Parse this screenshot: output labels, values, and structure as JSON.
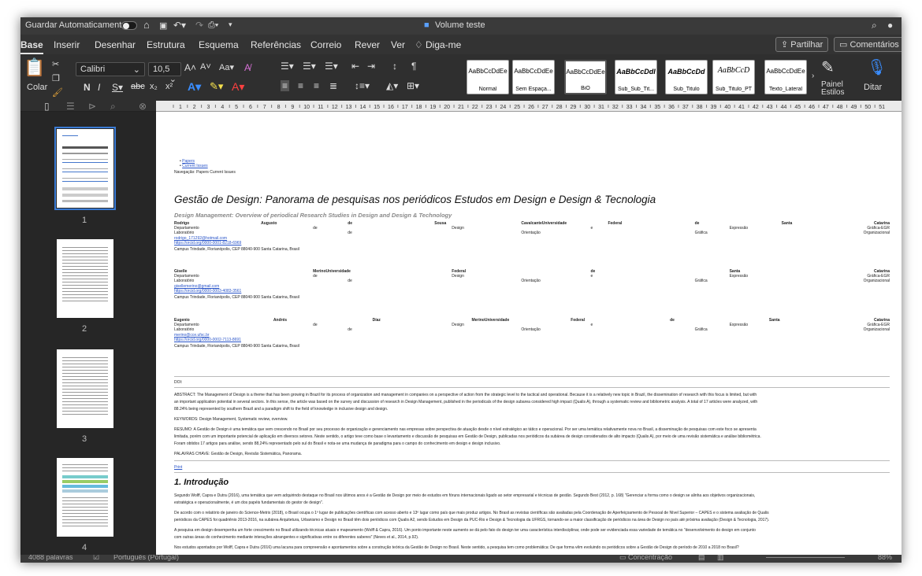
{
  "titlebar": {
    "autosave": "Guardar Automaticamente",
    "doc_title": "Volume teste"
  },
  "menu": {
    "tabs": [
      "Base",
      "Inserir",
      "Desenhar",
      "Estrutura",
      "Esquema",
      "Referências",
      "Correio",
      "Rever",
      "Ver"
    ],
    "tell_me": "Diga-me",
    "share": "Partilhar",
    "comments": "Comentários"
  },
  "ribbon": {
    "paste": "Colar",
    "font": "Calibri",
    "size": "10,5",
    "styles_pane": "Painel Estilos",
    "dictate": "Ditar",
    "styles": [
      {
        "preview": "AaBbCcDdEe",
        "name": "Normal"
      },
      {
        "preview": "AaBbCcDdEe",
        "name": "Sem Espaça..."
      },
      {
        "preview": "AaBbCcDdEe",
        "name": "BiO"
      },
      {
        "preview": "AaBbCcDdI",
        "name": "Sub_Sub_Tit..."
      },
      {
        "preview": "AaBbCcDd",
        "name": "Sub_Titulo"
      },
      {
        "preview": "AaBbCcD",
        "name": "Sub_Titulo_PT"
      },
      {
        "preview": "AaBbCcDdEe",
        "name": "Texto_Lateral"
      }
    ]
  },
  "nav": {
    "pages": [
      "1",
      "2",
      "3",
      "4"
    ]
  },
  "ruler": [
    "1",
    "2",
    "3",
    "4",
    "5",
    "6",
    "7",
    "8",
    "9",
    "10",
    "11",
    "12",
    "13",
    "14",
    "15",
    "16",
    "17",
    "18",
    "19",
    "20",
    "21",
    "22",
    "23",
    "24",
    "25",
    "26",
    "27",
    "28",
    "29",
    "30",
    "31",
    "32",
    "33",
    "34",
    "35",
    "36",
    "37",
    "38",
    "39",
    "40",
    "41",
    "42",
    "43",
    "44",
    "45",
    "46",
    "47",
    "48",
    "49",
    "50",
    "51"
  ],
  "doc": {
    "links": [
      "Papers",
      "Current Issues"
    ],
    "breadcrumb": "Navegação: Papers Current Issues",
    "title": "Gestão de Design: Panorama de pesquisas nos periódicos Estudos em Design e Design & Tecnologia",
    "subtitle": "Design Management: Overview of periodical Research Studies in Design and Design & Technology",
    "authors": [
      {
        "name": [
          "Rodrigo",
          "Augusto",
          "de",
          "Sousa",
          "CavalcanteUniversidade",
          "Federal",
          "de",
          "Santa",
          "Catarina"
        ],
        "dept": [
          "Departamento",
          "de",
          "Design",
          "e",
          "Expressão",
          "Gráfica-EGR"
        ],
        "lab": [
          "Laboratório",
          "de",
          "Orientação",
          "Gráfica",
          "Organizacional"
        ],
        "email": "rodrigo_171292@hotmail.com",
        "orcid": "https://orcid.org/0000-0001-8218-6969",
        "addr": "Campus Trindade, Florianópolis, CEP 88040-900 Santa Catarina, Brasil"
      },
      {
        "name": [
          "Giselle",
          "MerinoUniversidade",
          "Federal",
          "de",
          "Santa",
          "Catarina"
        ],
        "dept": [
          "Departamento",
          "de",
          "Design",
          "e",
          "Expressão",
          "Gráfica-EGR"
        ],
        "lab": [
          "Laboratório",
          "de",
          "Orientação",
          "Gráfica",
          "Organizacional"
        ],
        "email": "gisellemerino@gmail.com",
        "orcid": "https://orcid.org/0000-0003-4083-3561",
        "addr": "Campus Trindade, Florianópolis, CEP 88040-900 Santa Catarina, Brasil"
      },
      {
        "name": [
          "Eugenio",
          "Andrés",
          "Díaz",
          "MerinoUniversidade",
          "Federal",
          "de",
          "Santa",
          "Catarina"
        ],
        "dept": [
          "Departamento",
          "de",
          "Design",
          "e",
          "Expressão",
          "Gráfica-EGR"
        ],
        "lab": [
          "Laboratório",
          "de",
          "Orientação",
          "Gráfica",
          "Organizacional"
        ],
        "email": "merino@cce.ufsc.br",
        "orcid": "https://orcid.org/0000-0002-7113-8691",
        "addr": "Campus Trindade, Florianópolis, CEP 88040-900 Santa Catarina, Brasil"
      }
    ],
    "doi": "DOI:",
    "abstract": [
      "ABSTRACT: The Management of Design is a theme that has been growing in Brazil for its process of organization and management in companies on a perspective of action from the strategic level to the tactical and operational. Because it is a relatively new topic in Brazil, the dissemination of research with this focus is limited, but with",
      "an important application potential in several sectors. In this sense, the article was based on the survey and discussion of research in Design Management, published in the periodicals of the design subarea considered high impact (Qualis A), through a systematic review and bibliometric analysis. A total of 17 articles were analyzed, with",
      "88.24% being represented by southern Brazil and a paradigm shift to the field of knowledge in inclusive design and design."
    ],
    "keywords": "KEYWORDS: Design Management, Systematic review, overview.",
    "resumo": [
      "RESUMO: A Gestão de Design é uma temática que vem crescendo no Brasil por seu processo de organização e gerenciamento nas empresas sobre perspectiva de atuação desde o nível estratégico ao tático e operacional. Por ser uma temática relativamente nova no Brasil, a disseminação de pesquisas com este foco se apresenta",
      "limitada, porém com um importante potencial de aplicação em diversos setores. Neste sentido, o artigo teve como base o levantamento e discussão de pesquisas em Gestão de Design, publicadas nos periódicos da subárea de design considerados de alto impacto (Qualis A), por meio de uma revisão sistemática e análise bibliométrica.",
      "Foram obtidos 17 artigos para análise, sendo 88,24% representado pelo sul do Brasil e nota-se uma mudança de paradigma para o campo do conhecimento em design e design inclusivo."
    ],
    "palavras": "PALAVRAS CHAVE: Gestão de Design, Revisão Sistemática, Panorama.",
    "print": "Print",
    "intro_heading": "1. Introdução",
    "intro": [
      "Segundo Wolff, Capra e Dutra (2016), uma temática que vem adquirindo destaque no Brasil nos últimos anos é a Gestão de Design por meio de estudos em fóruns internacionais ligado ao setor empresarial e técnicas de gestão. Segundo Best (2012, p. 168) \"Gerenciar a forma como o design se alinha aos objetivos organizacionais,",
      "estratégica e operacionalmente, é um dos papéis fundamentais do gestor de design\".",
      "De acordo com o relatório de janeiro do Science-Metrix (2018), o Brasil ocupa o 1º lugar de publicações científicas com acesso aberto e 13º lugar como país que mais produz artigos. No Brasil as revistas científicas são avaliadas pela Coordenação de Aperfeiçoamento de Pessoal de Nível Superior – CAPES e o sistema avaliação de Qualis",
      "periódicos da CAPES foi quadriênio 2013-2016, na subárea Arquitetura, Urbanismo e Design no Brasil têm dois periódicos com Qualis A2, sendo Estudos em Design da PUC-Rio e Design & Tecnologia da UFRGS, tornando-se a maior classificação de periódicos na área de Design no país até próxima avaliação (Design & Tecnologia, 2017).",
      "A pesquisa em design desempenha um forte crescimento no Brasil utilizando técnicas atuais e mapeamento (Wolff & Capra, 2016). Um ponto importante neste aumento se dá pelo fato do design ter uma característica interdisciplinar, onde pode ser evidenciada essa variedade de temática no \"desenvolvimento do design em conjunto",
      "com outras áreas do conhecimento mediante interações abrangentes e significativas entre os diferentes saberes\" (Neves et al., 2014, p.92).",
      "Nos estudos apontados por Wolff, Capra e Dutra (2016) uma lacuna para compreensão e apontamentos sobre a construção teórica da Gestão de Design no Brasil. Neste sentido, a pesquisa tem como problemática: De que forma vêm evoluindo os periódicos sobre a Gestão de Design do período de 2010 a 2018 no Brasil?"
    ]
  },
  "status": {
    "words": "4088 palavras",
    "language": "Português (Portugal)",
    "focus": "Concentração",
    "zoom": "88%"
  }
}
